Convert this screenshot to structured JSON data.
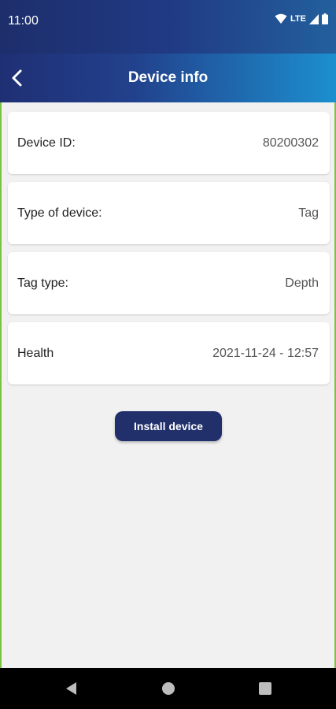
{
  "status_bar": {
    "time": "11:00",
    "network": "LTE",
    "icons": [
      "wifi-icon",
      "signal-icon",
      "battery-icon"
    ]
  },
  "app_bar": {
    "title": "Device info",
    "back_icon": "back-arrow-icon"
  },
  "details": [
    {
      "label": "Device ID:",
      "value": "80200302"
    },
    {
      "label": "Type of device:",
      "value": "Tag"
    },
    {
      "label": "Tag type:",
      "value": "Depth"
    },
    {
      "label": "Health",
      "value": "2021-11-24 - 12:57"
    }
  ],
  "actions": {
    "install_label": "Install device"
  },
  "nav_bar": {
    "icons": [
      "back-triangle-icon",
      "home-circle-icon",
      "recents-square-icon"
    ]
  },
  "colors": {
    "primary": "#21306b",
    "accent_border": "#7cc242",
    "header_start": "#1f2f74",
    "header_end": "#1c8fcf"
  }
}
